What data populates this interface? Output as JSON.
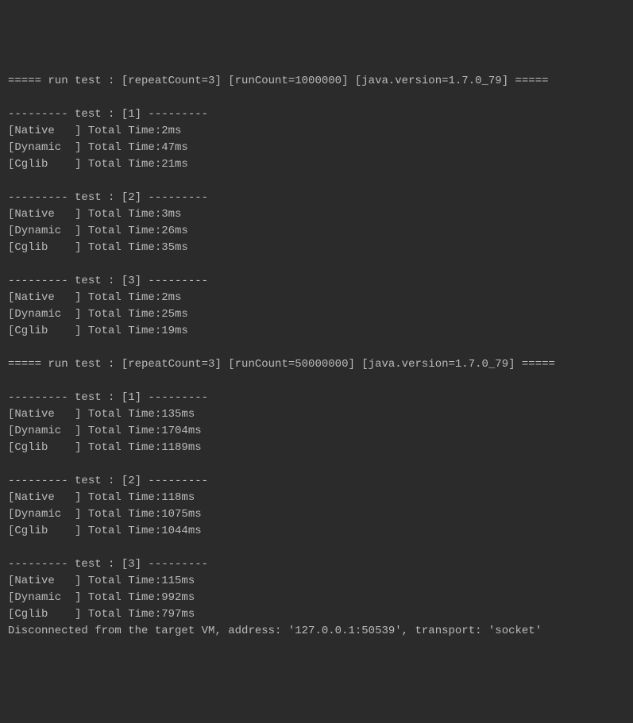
{
  "lines": [
    "===== run test : [repeatCount=3] [runCount=1000000] [java.version=1.7.0_79] =====",
    "",
    "--------- test : [1] ---------",
    "[Native   ] Total Time:2ms",
    "[Dynamic  ] Total Time:47ms",
    "[Cglib    ] Total Time:21ms",
    "",
    "--------- test : [2] ---------",
    "[Native   ] Total Time:3ms",
    "[Dynamic  ] Total Time:26ms",
    "[Cglib    ] Total Time:35ms",
    "",
    "--------- test : [3] ---------",
    "[Native   ] Total Time:2ms",
    "[Dynamic  ] Total Time:25ms",
    "[Cglib    ] Total Time:19ms",
    "",
    "===== run test : [repeatCount=3] [runCount=50000000] [java.version=1.7.0_79] =====",
    "",
    "--------- test : [1] ---------",
    "[Native   ] Total Time:135ms",
    "[Dynamic  ] Total Time:1704ms",
    "[Cglib    ] Total Time:1189ms",
    "",
    "--------- test : [2] ---------",
    "[Native   ] Total Time:118ms",
    "[Dynamic  ] Total Time:1075ms",
    "[Cglib    ] Total Time:1044ms",
    "",
    "--------- test : [3] ---------",
    "[Native   ] Total Time:115ms",
    "[Dynamic  ] Total Time:992ms",
    "[Cglib    ] Total Time:797ms",
    "Disconnected from the target VM, address: '127.0.0.1:50539', transport: 'socket'"
  ]
}
